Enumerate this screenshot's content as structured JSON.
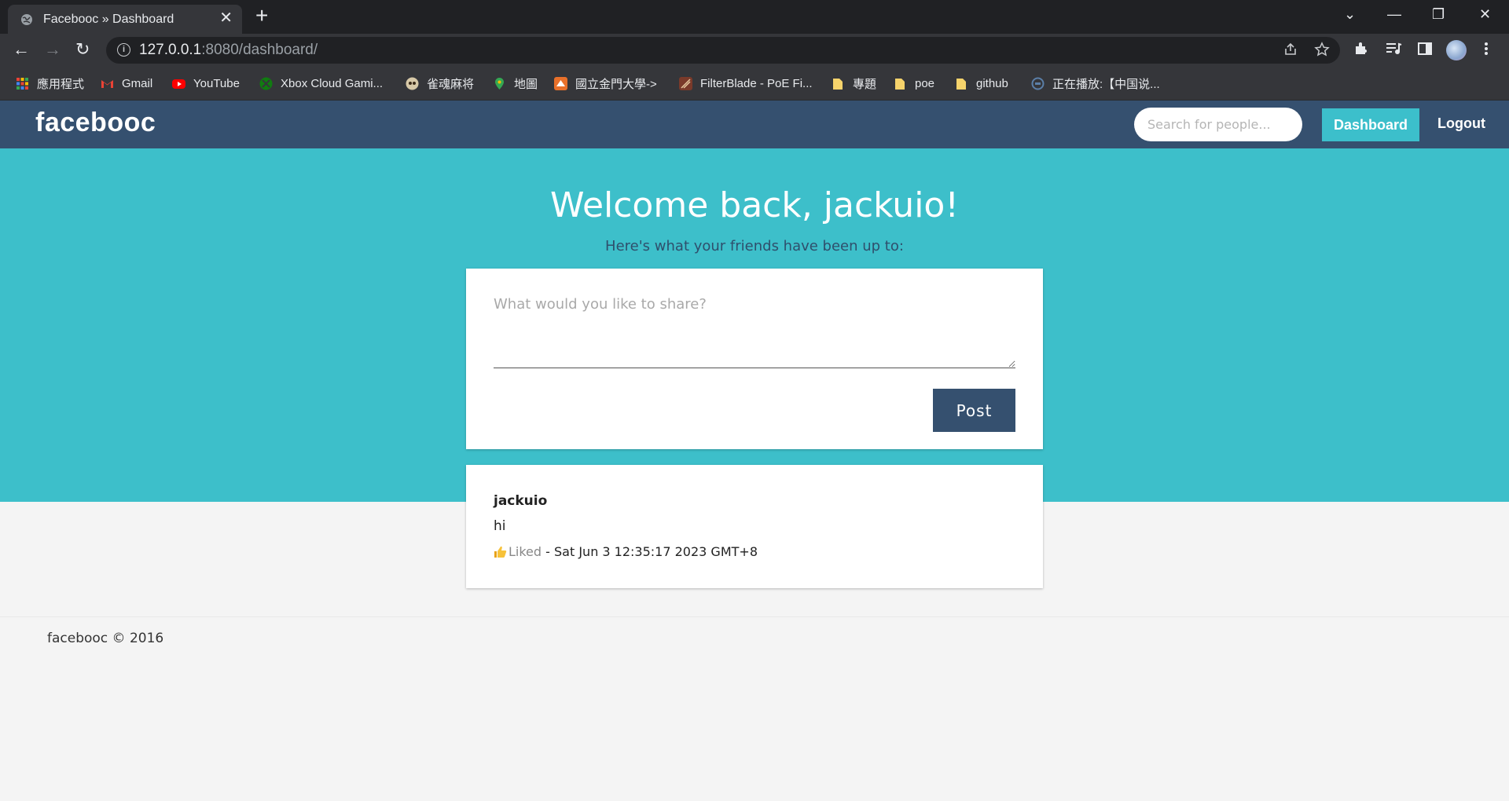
{
  "browser": {
    "tab_title": "Facebooc » Dashboard",
    "tab_close": "✕",
    "new_tab": "+",
    "url_host": "127.0.0.1",
    "url_rest": ":8080/dashboard/",
    "window_controls": [
      "⌄",
      "—",
      "❐",
      "✕"
    ],
    "nav": {
      "back": "←",
      "forward": "→",
      "reload": "↻"
    },
    "toolbar_icons": [
      "share-icon",
      "star-icon",
      "extensions-icon",
      "media-icon",
      "sidepanel-icon",
      "profile-avatar",
      "menu-icon"
    ],
    "bookmarks": [
      {
        "label": "應用程式",
        "icon": "apps-grid-icon",
        "color": "#e94235"
      },
      {
        "label": "Gmail",
        "icon": "gmail-icon",
        "color": "#ea4335"
      },
      {
        "label": "YouTube",
        "icon": "youtube-icon",
        "color": "#ff0000"
      },
      {
        "label": "Xbox Cloud Gami...",
        "icon": "xbox-icon",
        "color": "#107c10"
      },
      {
        "label": "雀魂麻将",
        "icon": "mahjong-icon",
        "color": "#6b5a3a"
      },
      {
        "label": "地圖",
        "icon": "maps-pin-icon",
        "color": "#34a853"
      },
      {
        "label": "國立金門大學->",
        "icon": "university-icon",
        "color": "#e8702a"
      },
      {
        "label": "FilterBlade - PoE Fi...",
        "icon": "filterblade-icon",
        "color": "#7a3a2a"
      },
      {
        "label": "專題",
        "icon": "folder-icon",
        "color": "#f6d36b"
      },
      {
        "label": "poe",
        "icon": "folder-icon",
        "color": "#f6d36b"
      },
      {
        "label": "github",
        "icon": "folder-icon",
        "color": "#f6d36b"
      },
      {
        "label": "正在播放:【中国说...",
        "icon": "music-site-icon",
        "color": "#5b7fa8"
      }
    ]
  },
  "site": {
    "logo": "facebooc",
    "search_placeholder": "Search for people...",
    "dashboard_label": "Dashboard",
    "logout_label": "Logout"
  },
  "hero": {
    "welcome": "Welcome back, jackuio!",
    "subtitle": "Here's what your friends have been up to:"
  },
  "compose": {
    "placeholder": "What would you like to share?",
    "post_label": "Post"
  },
  "feed": [
    {
      "author": "jackuio",
      "content": "hi",
      "liked_label": "Liked",
      "timestamp": " - Sat Jun 3 12:35:17 2023 GMT+8"
    }
  ],
  "footer": {
    "text": "facebooc © 2016"
  },
  "colors": {
    "nav_bg": "#35506f",
    "hero_bg": "#3dbfca",
    "accent": "#3cbfcb",
    "page_bg": "#f4f4f4"
  }
}
